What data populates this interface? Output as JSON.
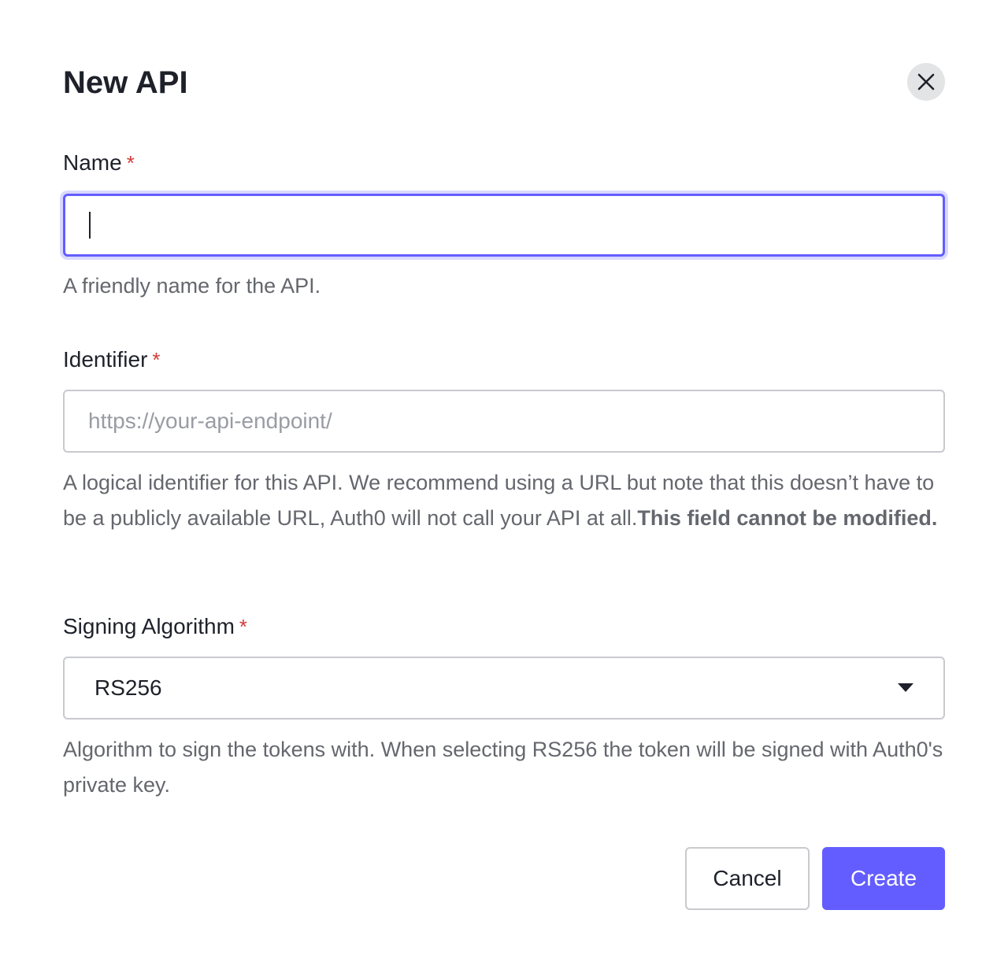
{
  "dialog": {
    "title": "New API",
    "close_icon": "close-icon"
  },
  "name_field": {
    "label": "Name",
    "required_mark": "*",
    "value": "",
    "help": "A friendly name for the API."
  },
  "identifier_field": {
    "label": "Identifier",
    "required_mark": "*",
    "placeholder": "https://your-api-endpoint/",
    "help": "A logical identifier for this API. We recommend using a URL but note that this doesn’t have to be a publicly available URL, Auth0 will not call your API at all.",
    "help_bold": "This field cannot be modified."
  },
  "signing_algorithm_field": {
    "label": "Signing Algorithm",
    "required_mark": "*",
    "selected": "RS256",
    "dropdown_icon": "caret-down-icon",
    "help": "Algorithm to sign the tokens with. When selecting RS256 the token will be signed with Auth0's private key."
  },
  "actions": {
    "cancel_label": "Cancel",
    "create_label": "Create"
  },
  "colors": {
    "accent": "#635dff",
    "required": "#d03c38",
    "text": "#1e212a",
    "muted": "#65676e",
    "border": "#c9cace"
  }
}
